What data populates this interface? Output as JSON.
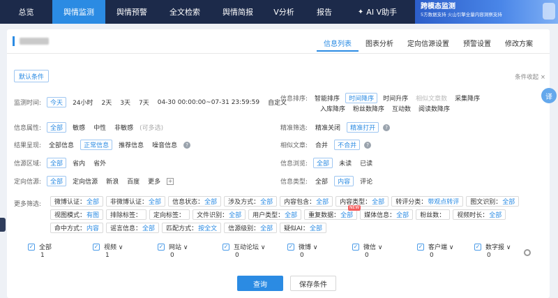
{
  "nav": {
    "items": [
      "总览",
      "舆情监测",
      "舆情预警",
      "全文检索",
      "舆情简报",
      "V分析",
      "报告",
      "AI V助手"
    ],
    "active_index": 1
  },
  "promo": {
    "title": "跨模态监测",
    "subtitle": "5方数据支持  火山引擎全量内容洞察支持"
  },
  "tabs": [
    "信息列表",
    "图表分析",
    "定向信源设置",
    "预警设置",
    "修改方案"
  ],
  "default_condition": "默认条件",
  "collapse_label": "条件收起",
  "translate_icon_text": "译",
  "filters": {
    "time": {
      "label": "监测时间:",
      "options": [
        "今天",
        "24小时",
        "2天",
        "3天",
        "7天"
      ],
      "range": "04-30 00:00:00~07-31 23:59:59",
      "custom": "自定义"
    },
    "sort": {
      "label": "信息排序:",
      "options": [
        "智能排序",
        "时间降序",
        "时间升序",
        "相似文章数",
        "采集降序",
        "入库降序",
        "粉丝数降序",
        "互动数",
        "阅读数降序"
      ]
    },
    "attr": {
      "label": "信息属性:",
      "options": [
        "全部",
        "敏感",
        "中性",
        "非敏感"
      ],
      "hint": "(可多选)"
    },
    "precise": {
      "label": "精准筛选:",
      "options": [
        "精准关闭",
        "精准打开"
      ]
    },
    "result": {
      "label": "结果呈现:",
      "options": [
        "全部信息",
        "正常信息",
        "推荐信息",
        "噪音信息"
      ]
    },
    "similar": {
      "label": "相似文章:",
      "options": [
        "合并",
        "不合并"
      ]
    },
    "region": {
      "label": "信源区域:",
      "options": [
        "全部",
        "省内",
        "省外"
      ]
    },
    "browse": {
      "label": "信息浏览:",
      "options": [
        "全部",
        "未读",
        "已读"
      ]
    },
    "source": {
      "label": "定向信源:",
      "options": [
        "全部",
        "定向信源",
        "新浪",
        "百度",
        "更多"
      ]
    },
    "type": {
      "label": "信息类型:",
      "options": [
        "全部",
        "内容",
        "评论"
      ]
    }
  },
  "more": {
    "label": "更多筛选:",
    "tags": [
      {
        "k": "微博认证：",
        "v": "全部"
      },
      {
        "k": "非微博认证：",
        "v": "全部"
      },
      {
        "k": "信息状态：",
        "v": "全部"
      },
      {
        "k": "涉及方式：",
        "v": "全部"
      },
      {
        "k": "内容包含：",
        "v": "全部"
      },
      {
        "k": "内容类型：",
        "v": "全部"
      },
      {
        "k": "转评分类：",
        "v": "带观点转评"
      },
      {
        "k": "图文识别：",
        "v": "全部"
      },
      {
        "k": "视图模式：",
        "v": "有图"
      },
      {
        "k": "排除标签：",
        "v": ""
      },
      {
        "k": "定向标签：",
        "v": ""
      },
      {
        "k": "文件识别：",
        "v": "全部"
      },
      {
        "k": "用户类型：",
        "v": "全部"
      },
      {
        "k": "重复数据：",
        "v": "全部"
      },
      {
        "k": "媒体信息：",
        "v": "全部"
      },
      {
        "k": "粉丝数：",
        "v": ""
      },
      {
        "k": "视频时长：",
        "v": "全部"
      },
      {
        "k": "命中方式：",
        "v": "内容"
      },
      {
        "k": "谣言信息：",
        "v": "全部"
      },
      {
        "k": "匹配方式：",
        "v": "按全文"
      },
      {
        "k": "信源级别：",
        "v": "全部"
      },
      {
        "k": "疑似AI：",
        "v": "全部"
      }
    ],
    "new_badge": "NEW"
  },
  "media": [
    {
      "name": "全部",
      "count": "1"
    },
    {
      "name": "视频 ∨",
      "count": "1"
    },
    {
      "name": "网站 ∨",
      "count": "0"
    },
    {
      "name": "互动论坛 ∨",
      "count": "0"
    },
    {
      "name": "微博 ∨",
      "count": "0"
    },
    {
      "name": "微信 ∨",
      "count": "0"
    },
    {
      "name": "客户端 ∨",
      "count": "0"
    },
    {
      "name": "数字报 ∨",
      "count": "0"
    }
  ],
  "buttons": {
    "query": "查询",
    "save": "保存条件"
  }
}
